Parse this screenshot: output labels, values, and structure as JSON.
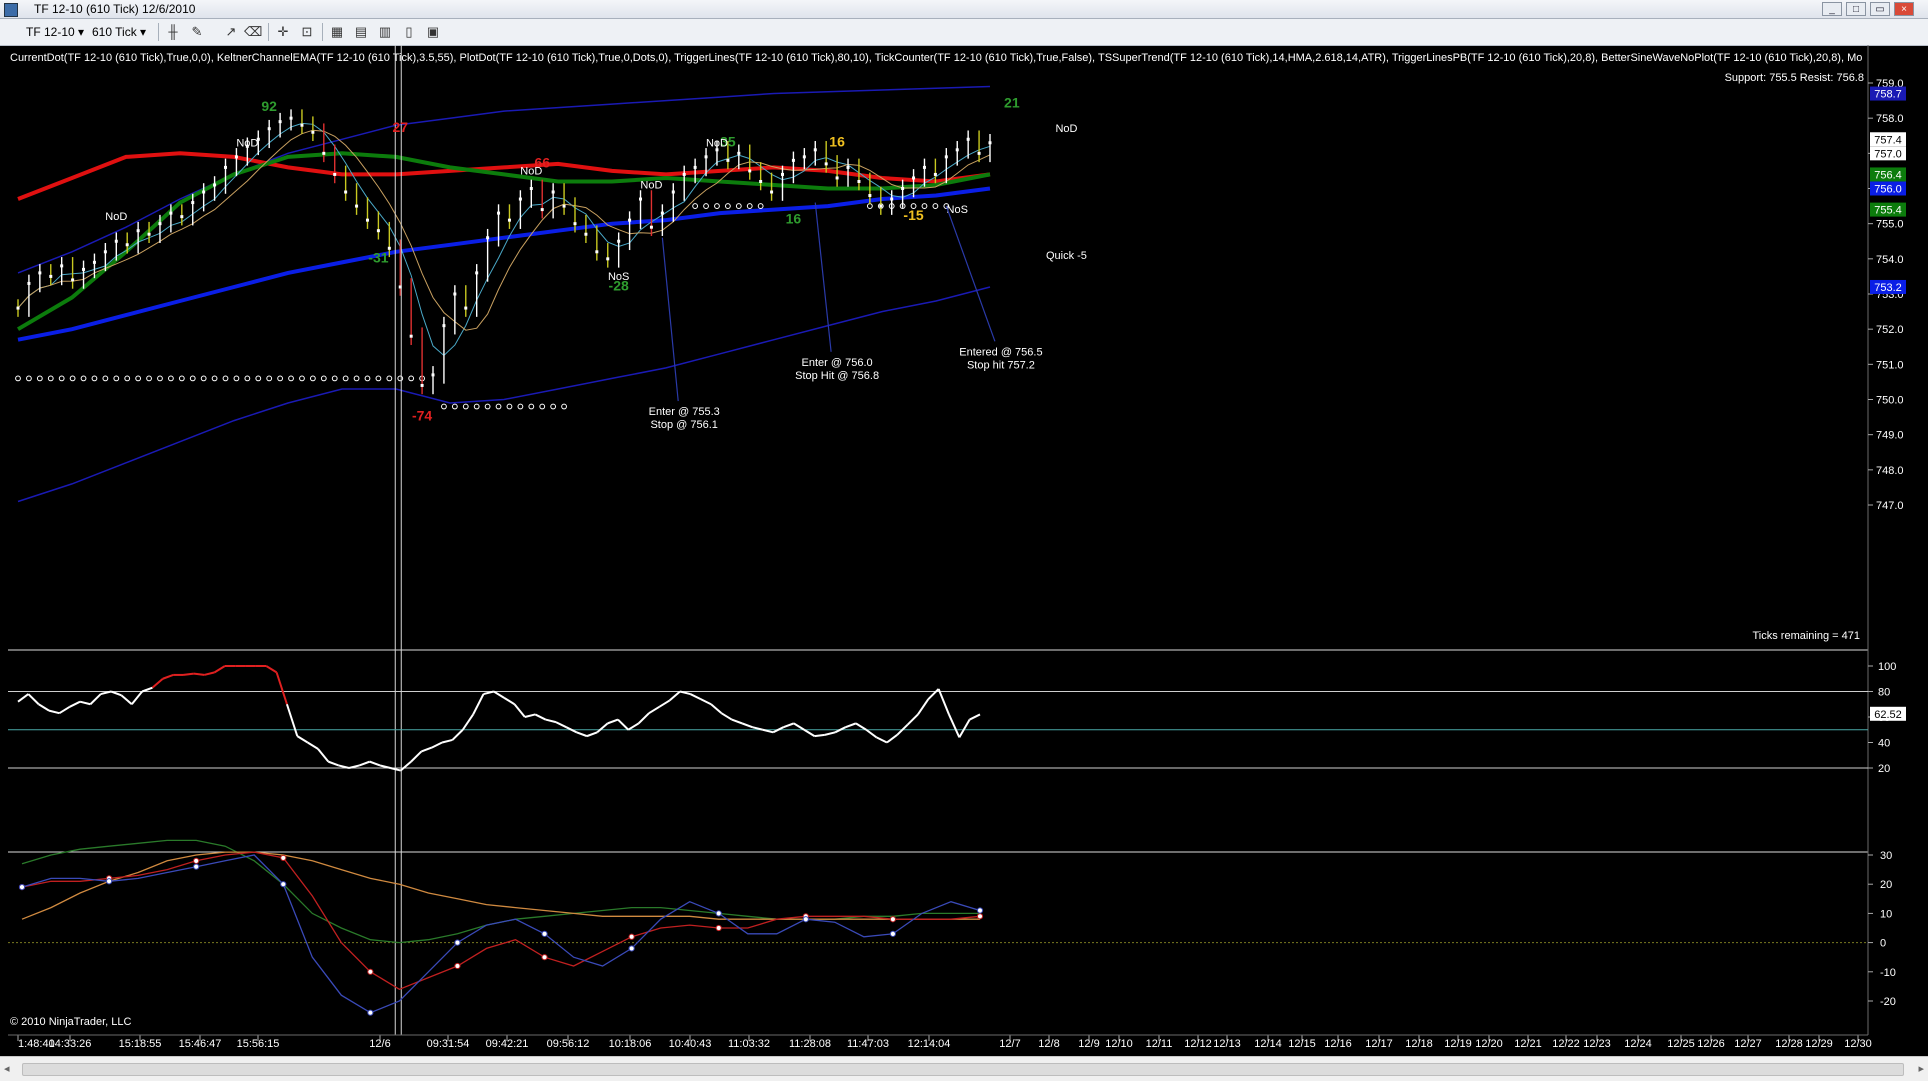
{
  "window": {
    "title": "TF 12-10 (610 Tick)  12/6/2010",
    "minimize": "_",
    "maximize": "□",
    "close": "×"
  },
  "toolbar": {
    "instrument": "TF 12-10",
    "interval": "610 Tick"
  },
  "icons": [
    "chart-icon",
    "bar-type-icon",
    "pencil-icon",
    "crosshair-icon",
    "zoom-icon",
    "properties-icon"
  ],
  "colors": {
    "background": "#000000",
    "price_bar": "#ffffff",
    "keltner_outer": "#1a1ab4",
    "keltner_mid": "#0a1ee6",
    "trigger_fast": "#e01010",
    "trigger_slow": "#0c7c0c",
    "osc_cyan": "#4aa9a8",
    "support": "#2a8a2a"
  },
  "chart_data": [
    {
      "type": "line",
      "panel": "price",
      "indicator_header": "CurrentDot(TF 12-10 (610 Tick),True,0,0), KeltnerChannelEMA(TF 12-10 (610 Tick),3.5,55), PlotDot(TF 12-10 (610 Tick),True,0,Dots,0), TriggerLines(TF 12-10 (610 Tick),80,10), TickCounter(TF 12-10 (610 Tick),True,False), TSSuperTrend(TF 12-10 (610 Tick),14,HMA,2.618,14,ATR), TriggerLinesPB(TF 12-10 (610 Tick),20,8), BetterSineWaveNoPlot(TF 12-10 (610 Tick),20,8), Mo",
      "support_resist": "Support: 755.5  Resist: 756.8",
      "ticks_remaining": "Ticks remaining = 471",
      "y_ticks": [
        "759.0",
        "758.0",
        "757.0",
        "756.0",
        "755.0",
        "754.0",
        "753.0",
        "752.0",
        "751.0",
        "750.0",
        "749.0",
        "748.0",
        "747.0"
      ],
      "ylim": [
        746.6,
        759.4
      ],
      "price_tags": [
        {
          "value": 758.7,
          "text": "758.7",
          "color": "#1a1ab4",
          "fg": "#ffffff"
        },
        {
          "value": 757.4,
          "text": "757.4",
          "color": "#ffffff",
          "fg": "#000000"
        },
        {
          "value": 757.0,
          "text": "757.0",
          "color": "#ffffff",
          "fg": "#000000"
        },
        {
          "value": 756.4,
          "text": "756.4",
          "color": "#0c7c0c",
          "fg": "#ffffff"
        },
        {
          "value": 756.0,
          "text": "756.0",
          "color": "#0a1ee6",
          "fg": "#ffffff"
        },
        {
          "value": 755.4,
          "text": "755.4",
          "color": "#0c7c0c",
          "fg": "#ffffff"
        },
        {
          "value": 753.2,
          "text": "753.2",
          "color": "#0a1ee6",
          "fg": "#ffffff"
        }
      ],
      "closes": [
        752.6,
        753.3,
        753.6,
        753.5,
        753.8,
        753.4,
        753.7,
        753.9,
        754.2,
        754.5,
        754.4,
        754.8,
        754.7,
        755.0,
        755.3,
        755.2,
        755.6,
        755.9,
        756.1,
        756.6,
        756.9,
        757.2,
        757.4,
        757.7,
        757.9,
        758.0,
        757.8,
        757.6,
        757.0,
        756.4,
        755.9,
        755.5,
        755.1,
        754.8,
        754.3,
        753.2,
        751.8,
        750.4,
        750.7,
        752.1,
        753.0,
        752.6,
        753.6,
        754.6,
        755.3,
        755.1,
        755.7,
        756.0,
        755.4,
        755.9,
        755.5,
        755.0,
        754.7,
        754.2,
        754.0,
        754.5,
        755.1,
        755.7,
        754.9,
        755.3,
        755.9,
        756.4,
        756.6,
        756.9,
        757.1,
        756.8,
        757.0,
        756.5,
        756.2,
        755.9,
        756.4,
        756.8,
        756.9,
        757.1,
        756.7,
        756.3,
        756.6,
        756.2,
        755.8,
        755.5,
        755.7,
        756.0,
        756.3,
        756.6,
        756.4,
        756.9,
        757.1,
        757.4,
        757.0,
        757.3
      ],
      "series": [
        {
          "name": "KeltnerUpper",
          "values": [
            753.6,
            754.2,
            754.9,
            755.7,
            756.4,
            757.0,
            757.4,
            757.8,
            758.0,
            758.2,
            758.3,
            758.4,
            758.5,
            758.6,
            758.7,
            758.75,
            758.8,
            758.85,
            758.9
          ]
        },
        {
          "name": "KeltnerMid",
          "values": [
            751.7,
            752.0,
            752.4,
            752.8,
            753.2,
            753.6,
            753.9,
            754.2,
            754.4,
            754.6,
            754.8,
            755.0,
            755.1,
            755.3,
            755.4,
            755.5,
            755.7,
            755.8,
            756.0
          ]
        },
        {
          "name": "KeltnerLower",
          "values": [
            747.1,
            747.6,
            748.2,
            748.8,
            749.4,
            749.9,
            750.3,
            750.3,
            749.9,
            750.0,
            750.3,
            750.6,
            750.9,
            751.3,
            751.7,
            752.1,
            752.5,
            752.8,
            753.2
          ]
        },
        {
          "name": "TriggerFast",
          "values": [
            755.7,
            756.3,
            756.9,
            757.0,
            756.9,
            756.6,
            756.4,
            756.4,
            756.5,
            756.6,
            756.7,
            756.5,
            756.4,
            756.5,
            756.6,
            756.5,
            756.3,
            756.2,
            756.4
          ]
        },
        {
          "name": "TriggerSlow",
          "values": [
            752.0,
            752.9,
            754.2,
            755.6,
            756.4,
            756.9,
            757.0,
            756.9,
            756.6,
            756.4,
            756.2,
            756.2,
            756.3,
            756.2,
            756.1,
            756.0,
            756.0,
            756.1,
            756.4
          ]
        }
      ],
      "superTrend": [
        {
          "from_bar": 0,
          "to_bar": 37,
          "value": 750.6
        },
        {
          "from_bar": 39,
          "to_bar": 50,
          "value": 749.8
        },
        {
          "from_bar": 62,
          "to_bar": 68,
          "value": 755.5
        },
        {
          "from_bar": 78,
          "to_bar": 85,
          "value": 755.5
        }
      ],
      "counts": [
        {
          "text": "92",
          "bar": 23,
          "value": 758.2,
          "color": "#2e9b2e"
        },
        {
          "text": "27",
          "bar": 35,
          "value": 757.6,
          "color": "#e02020"
        },
        {
          "text": "66",
          "bar": 48,
          "value": 756.6,
          "color": "#e02020"
        },
        {
          "text": "35",
          "bar": 65,
          "value": 757.2,
          "color": "#2e9b2e"
        },
        {
          "text": "16",
          "bar": 75,
          "value": 757.2,
          "color": "#f0c020"
        },
        {
          "text": "21",
          "bar": 91,
          "value": 758.3,
          "color": "#2e9b2e"
        },
        {
          "text": "-31",
          "bar": 33,
          "value": 753.9,
          "color": "#2e9b2e"
        },
        {
          "text": "-74",
          "bar": 37,
          "value": 749.4,
          "color": "#e02020"
        },
        {
          "text": "-28",
          "bar": 55,
          "value": 753.1,
          "color": "#2e9b2e"
        },
        {
          "text": "16",
          "bar": 71,
          "value": 755.0,
          "color": "#2e9b2e"
        },
        {
          "text": "-15",
          "bar": 82,
          "value": 755.1,
          "color": "#f0c020"
        }
      ],
      "labels": [
        {
          "text": "NoD",
          "bar": 9,
          "value": 755.1
        },
        {
          "text": "NoD",
          "bar": 21,
          "value": 757.2
        },
        {
          "text": "NoD",
          "bar": 47,
          "value": 756.4
        },
        {
          "text": "NoD",
          "bar": 58,
          "value": 756.0
        },
        {
          "text": "NoD",
          "bar": 64,
          "value": 757.2
        },
        {
          "text": "NoD",
          "bar": 96,
          "value": 757.6
        },
        {
          "text": "NoS",
          "bar": 55,
          "value": 753.4
        },
        {
          "text": "NoS",
          "bar": 86,
          "value": 755.3
        },
        {
          "text": "Quick -5",
          "bar": 96,
          "value": 754.0
        }
      ],
      "annotations": [
        {
          "lines": [
            "Enter @ 755.3",
            "Stop @ 756.1"
          ],
          "bar": 61,
          "value": 749.5,
          "arrow_bar": 59,
          "arrow_value": 754.6
        },
        {
          "lines": [
            "Enter @ 756.0",
            "Stop Hit @ 756.8"
          ],
          "bar": 75,
          "value": 750.9,
          "arrow_bar": 73,
          "arrow_value": 755.6
        },
        {
          "lines": [
            "Entered @ 756.5",
            "Stop hit 757.2"
          ],
          "bar": 90,
          "value": 751.2,
          "arrow_bar": 85,
          "arrow_value": 755.5
        }
      ]
    },
    {
      "type": "line",
      "panel": "oscillator",
      "y_ticks": [
        "100",
        "80",
        "60",
        "40",
        "20"
      ],
      "ylim": [
        16,
        104
      ],
      "reference_lines": [
        80,
        50,
        20
      ],
      "last_value": "62.52",
      "values": [
        72,
        78,
        70,
        65,
        63,
        68,
        72,
        70,
        78,
        80,
        77,
        70,
        80,
        83,
        90,
        93,
        93,
        94,
        93,
        95,
        100,
        100,
        100,
        100,
        100,
        95,
        70,
        45,
        40,
        35,
        25,
        22,
        20,
        22,
        25,
        22,
        20,
        18,
        25,
        33,
        36,
        40,
        42,
        50,
        62,
        78,
        80,
        75,
        70,
        60,
        62,
        58,
        56,
        52,
        48,
        45,
        48,
        55,
        58,
        50,
        55,
        63,
        68,
        73,
        80,
        78,
        74,
        70,
        63,
        58,
        55,
        52,
        50,
        48,
        52,
        55,
        50,
        45,
        46,
        48,
        52,
        55,
        50,
        44,
        40,
        46,
        54,
        62,
        74,
        82,
        62,
        44,
        58,
        62
      ]
    },
    {
      "type": "line",
      "panel": "sinewave",
      "y_ticks": [
        "30",
        "20",
        "10",
        "0",
        "-10",
        "-20"
      ],
      "ylim": [
        -22,
        34
      ],
      "series": [
        {
          "name": "green",
          "values": [
            27,
            30,
            32,
            33,
            34,
            35,
            35,
            33,
            28,
            20,
            10,
            5,
            1,
            0,
            1,
            3,
            6,
            8,
            9,
            10,
            11,
            12,
            12,
            11,
            10,
            9,
            8,
            8,
            8,
            9,
            9,
            10,
            10,
            10
          ]
        },
        {
          "name": "orange",
          "values": [
            8,
            12,
            17,
            21,
            24,
            28,
            30,
            31,
            31,
            30,
            28,
            25,
            22,
            20,
            17,
            15,
            13,
            12,
            11,
            10,
            9,
            9,
            9,
            9,
            8,
            8,
            8,
            8,
            8,
            8,
            8,
            8,
            8,
            8
          ]
        },
        {
          "name": "red",
          "values": [
            19,
            21,
            21,
            22,
            23,
            25,
            28,
            30,
            31,
            29,
            16,
            0,
            -10,
            -16,
            -12,
            -8,
            -2,
            1,
            -5,
            -8,
            -3,
            2,
            5,
            6,
            5,
            5,
            8,
            9,
            9,
            9,
            8,
            8,
            8,
            9
          ]
        },
        {
          "name": "blue",
          "values": [
            19,
            22,
            22,
            21,
            22,
            24,
            26,
            28,
            30,
            20,
            -5,
            -18,
            -24,
            -20,
            -10,
            0,
            6,
            8,
            3,
            -5,
            -8,
            -2,
            8,
            14,
            10,
            3,
            3,
            8,
            7,
            2,
            3,
            10,
            14,
            11
          ]
        }
      ]
    }
  ],
  "x_axis": {
    "ticks": [
      "1:48:40",
      "14:33:26",
      "15:18:55",
      "15:46:47",
      "15:56:15",
      "12/6",
      "09:31:54",
      "09:42:21",
      "09:56:12",
      "10:18:06",
      "10:40:43",
      "11:03:32",
      "11:28:08",
      "11:47:03",
      "12:14:04",
      "12/7",
      "12/8",
      "12/9",
      "12/10",
      "12/11",
      "12/12",
      "12/13",
      "12/14",
      "12/15",
      "12/16",
      "12/17",
      "12/18",
      "12/19",
      "12/20",
      "12/21",
      "12/22",
      "12/23",
      "12/24",
      "12/25",
      "12/26",
      "12/27",
      "12/28",
      "12/29",
      "12/30"
    ]
  },
  "copyright": "© 2010 NinjaTrader, LLC"
}
